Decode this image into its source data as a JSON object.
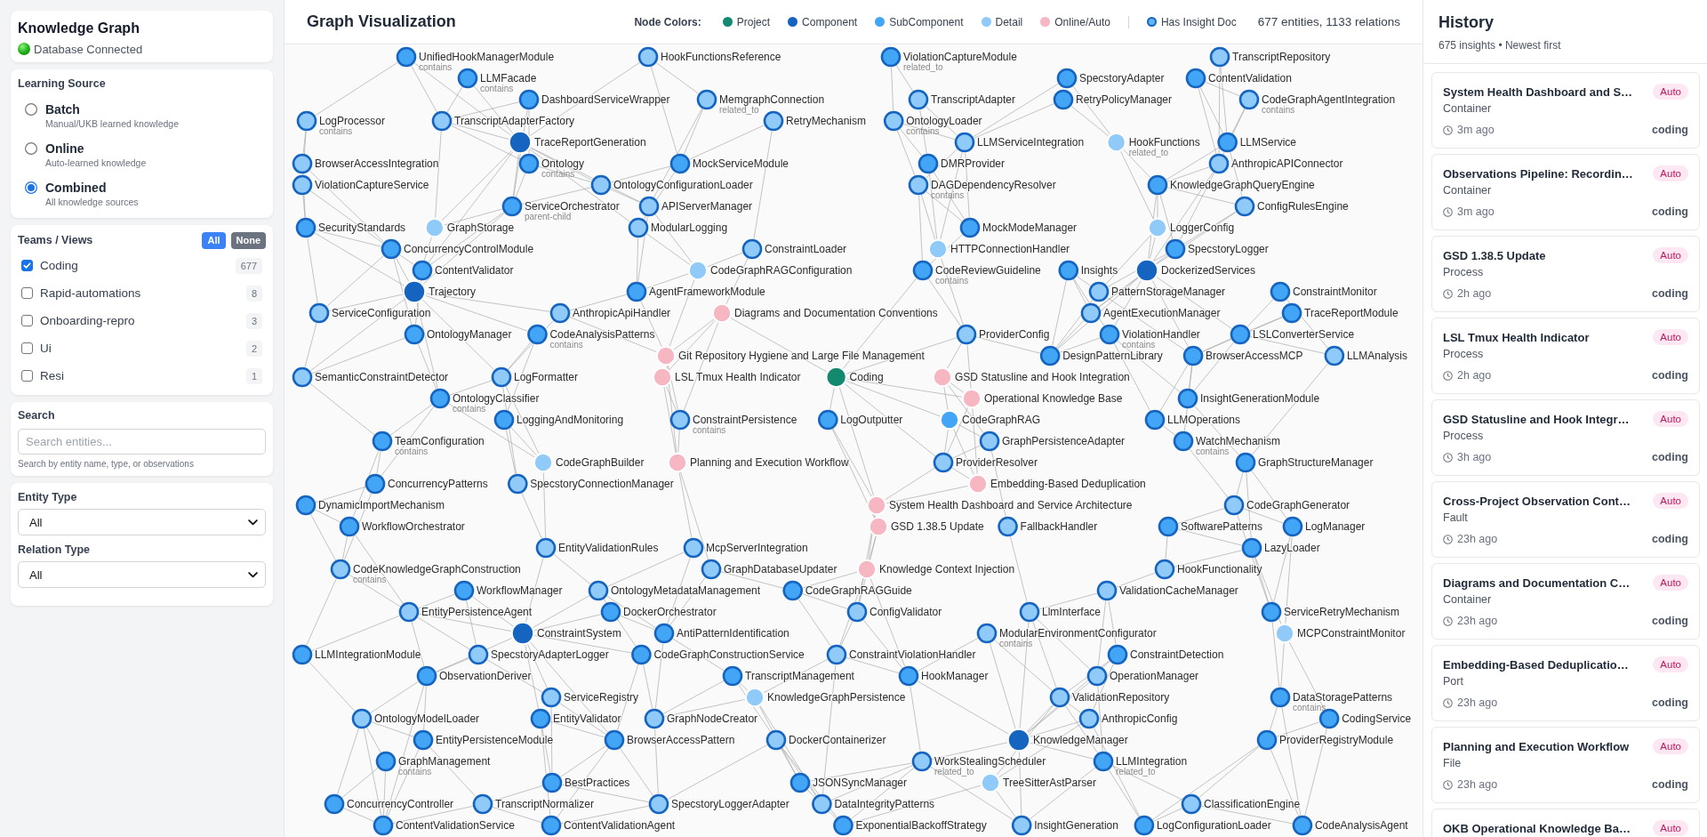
{
  "sidebar": {
    "title": "Knowledge Graph",
    "status": {
      "label": "Database Connected",
      "connected": true
    },
    "learning_source": {
      "label": "Learning Source",
      "options": [
        {
          "label": "Batch",
          "description": "Manual/UKB learned knowledge",
          "selected": false
        },
        {
          "label": "Online",
          "description": "Auto-learned knowledge",
          "selected": false
        },
        {
          "label": "Combined",
          "description": "All knowledge sources",
          "selected": true
        }
      ]
    },
    "teams": {
      "label": "Teams / Views",
      "buttons": [
        {
          "label": "All",
          "kind": "primary"
        },
        {
          "label": "None",
          "kind": "secondary"
        }
      ],
      "items": [
        {
          "name": "Coding",
          "checked": true,
          "count": "677"
        },
        {
          "name": "Rapid-automations",
          "checked": false,
          "count": "8"
        },
        {
          "name": "Onboarding-repro",
          "checked": false,
          "count": "3"
        },
        {
          "name": "Ui",
          "checked": false,
          "count": "2"
        },
        {
          "name": "Resi",
          "checked": false,
          "count": "1"
        }
      ]
    },
    "search": {
      "label": "Search",
      "placeholder": "Search entities...",
      "hint": "Search by entity name, type, or observations"
    },
    "filters": [
      {
        "label": "Entity Type",
        "value": "All"
      },
      {
        "label": "Relation Type",
        "value": "All"
      }
    ]
  },
  "graph": {
    "title": "Graph Visualization",
    "legend_title": "Node Colors:",
    "legend": [
      {
        "label": "Project",
        "kind": "project",
        "color": "#13896f"
      },
      {
        "label": "Component",
        "kind": "component",
        "color": "#1565c0"
      },
      {
        "label": "SubComponent",
        "kind": "subcomponent",
        "color": "#42a5f5"
      },
      {
        "label": "Detail",
        "kind": "detail",
        "color": "#90caf9"
      },
      {
        "label": "Online/Auto",
        "kind": "online",
        "color": "#f6b6c2"
      },
      {
        "label": "Has Insight Doc",
        "kind": "insight",
        "color": "#1565c0"
      }
    ],
    "stats": "677 entities, 1133 relations",
    "nodes": [
      {
        "name": "UnifiedHookManagerModule",
        "kind": "subcomponent",
        "insight_doc": true,
        "edge_label": "contains"
      },
      {
        "name": "HookFunctionsReference",
        "kind": "detail",
        "insight_doc": true
      },
      {
        "name": "ViolationCaptureModule",
        "kind": "subcomponent",
        "insight_doc": true,
        "edge_label": "related_to"
      },
      {
        "name": "TranscriptRepository",
        "kind": "detail",
        "insight_doc": true
      },
      {
        "name": "LLMFacade",
        "kind": "subcomponent",
        "insight_doc": true,
        "edge_label": "contains"
      },
      {
        "name": "SpecstoryAdapter",
        "kind": "subcomponent",
        "insight_doc": true
      },
      {
        "name": "ContentValidation",
        "kind": "subcomponent",
        "insight_doc": true
      },
      {
        "name": "DashboardServiceWrapper",
        "kind": "subcomponent",
        "insight_doc": true
      },
      {
        "name": "MemgraphConnection",
        "kind": "detail",
        "insight_doc": true,
        "edge_label": "related_to"
      },
      {
        "name": "TranscriptAdapter",
        "kind": "detail",
        "insight_doc": true
      },
      {
        "name": "RetryPolicyManager",
        "kind": "subcomponent",
        "insight_doc": true
      },
      {
        "name": "CodeGraphAgentIntegration",
        "kind": "detail",
        "insight_doc": true,
        "edge_label": "contains"
      },
      {
        "name": "LogProcessor",
        "kind": "detail",
        "insight_doc": true,
        "edge_label": "contains"
      },
      {
        "name": "TranscriptAdapterFactory",
        "kind": "detail",
        "insight_doc": true
      },
      {
        "name": "RetryMechanism",
        "kind": "detail",
        "insight_doc": true
      },
      {
        "name": "OntologyLoader",
        "kind": "detail",
        "insight_doc": true,
        "edge_label": "contains"
      },
      {
        "name": "TraceReportGeneration",
        "kind": "component",
        "insight_doc": false
      },
      {
        "name": "LLMServiceIntegration",
        "kind": "detail",
        "insight_doc": true
      },
      {
        "name": "HookFunctions",
        "kind": "detail",
        "insight_doc": false,
        "edge_label": "related_to"
      },
      {
        "name": "LLMService",
        "kind": "subcomponent",
        "insight_doc": true
      },
      {
        "name": "BrowserAccessIntegration",
        "kind": "detail",
        "insight_doc": true
      },
      {
        "name": "Ontology",
        "kind": "subcomponent",
        "insight_doc": true,
        "edge_label": "contains"
      },
      {
        "name": "MockServiceModule",
        "kind": "subcomponent",
        "insight_doc": true
      },
      {
        "name": "DMRProvider",
        "kind": "subcomponent",
        "insight_doc": true
      },
      {
        "name": "AnthropicAPIConnector",
        "kind": "detail",
        "insight_doc": true
      },
      {
        "name": "ViolationCaptureService",
        "kind": "detail",
        "insight_doc": true
      },
      {
        "name": "OntologyConfigurationLoader",
        "kind": "detail",
        "insight_doc": true
      },
      {
        "name": "DAGDependencyResolver",
        "kind": "detail",
        "insight_doc": true,
        "edge_label": "contains"
      },
      {
        "name": "KnowledgeGraphQueryEngine",
        "kind": "subcomponent",
        "insight_doc": true
      },
      {
        "name": "ServiceOrchestrator",
        "kind": "subcomponent",
        "insight_doc": true,
        "edge_label": "parent-child"
      },
      {
        "name": "APIServerManager",
        "kind": "detail",
        "insight_doc": true
      },
      {
        "name": "ConfigRulesEngine",
        "kind": "detail",
        "insight_doc": true
      },
      {
        "name": "SecurityStandards",
        "kind": "subcomponent",
        "insight_doc": true
      },
      {
        "name": "GraphStorage",
        "kind": "detail",
        "insight_doc": false
      },
      {
        "name": "ModularLogging",
        "kind": "detail",
        "insight_doc": true
      },
      {
        "name": "MockModeManager",
        "kind": "subcomponent",
        "insight_doc": true
      },
      {
        "name": "LoggerConfig",
        "kind": "detail",
        "insight_doc": false
      },
      {
        "name": "ConcurrencyControlModule",
        "kind": "subcomponent",
        "insight_doc": true
      },
      {
        "name": "ConstraintLoader",
        "kind": "detail",
        "insight_doc": true
      },
      {
        "name": "HTTPConnectionHandler",
        "kind": "detail",
        "insight_doc": false
      },
      {
        "name": "SpecstoryLogger",
        "kind": "subcomponent",
        "insight_doc": true
      },
      {
        "name": "ContentValidator",
        "kind": "subcomponent",
        "insight_doc": true
      },
      {
        "name": "CodeGraphRAGConfiguration",
        "kind": "detail",
        "insight_doc": false
      },
      {
        "name": "CodeReviewGuideline",
        "kind": "subcomponent",
        "insight_doc": true,
        "edge_label": "contains"
      },
      {
        "name": "Insights",
        "kind": "subcomponent",
        "insight_doc": true
      },
      {
        "name": "DockerizedServices",
        "kind": "component",
        "insight_doc": false
      },
      {
        "name": "Trajectory",
        "kind": "component",
        "insight_doc": false
      },
      {
        "name": "AgentFrameworkModule",
        "kind": "subcomponent",
        "insight_doc": true
      },
      {
        "name": "PatternStorageManager",
        "kind": "detail",
        "insight_doc": true
      },
      {
        "name": "ConstraintMonitor",
        "kind": "subcomponent",
        "insight_doc": true
      },
      {
        "name": "ServiceConfiguration",
        "kind": "detail",
        "insight_doc": true
      },
      {
        "name": "AnthropicApiHandler",
        "kind": "detail",
        "insight_doc": true
      },
      {
        "name": "Diagrams and Documentation Conventions",
        "kind": "online",
        "insight_doc": false
      },
      {
        "name": "AgentExecutionManager",
        "kind": "detail",
        "insight_doc": true
      },
      {
        "name": "TraceReportModule",
        "kind": "subcomponent",
        "insight_doc": true
      },
      {
        "name": "OntologyManager",
        "kind": "subcomponent",
        "insight_doc": true
      },
      {
        "name": "CodeAnalysisPatterns",
        "kind": "subcomponent",
        "insight_doc": true,
        "edge_label": "contains"
      },
      {
        "name": "ProviderConfig",
        "kind": "detail",
        "insight_doc": true
      },
      {
        "name": "ViolationHandler",
        "kind": "subcomponent",
        "insight_doc": true,
        "edge_label": "contains"
      },
      {
        "name": "LSLConverterService",
        "kind": "subcomponent",
        "insight_doc": true
      },
      {
        "name": "Git Repository Hygiene and Large File Management",
        "kind": "online",
        "insight_doc": false
      },
      {
        "name": "DesignPatternLibrary",
        "kind": "subcomponent",
        "insight_doc": true
      },
      {
        "name": "BrowserAccessMCP",
        "kind": "subcomponent",
        "insight_doc": true
      },
      {
        "name": "LLMAnalysis",
        "kind": "detail",
        "insight_doc": true
      },
      {
        "name": "SemanticConstraintDetector",
        "kind": "detail",
        "insight_doc": true
      },
      {
        "name": "LogFormatter",
        "kind": "detail",
        "insight_doc": true
      },
      {
        "name": "LSL Tmux Health Indicator",
        "kind": "online",
        "insight_doc": false
      },
      {
        "name": "Coding",
        "kind": "project",
        "insight_doc": false
      },
      {
        "name": "GSD Statusline and Hook Integration",
        "kind": "online",
        "insight_doc": false
      },
      {
        "name": "OntologyClassifier",
        "kind": "subcomponent",
        "insight_doc": true,
        "edge_label": "contains"
      },
      {
        "name": "Operational Knowledge Base",
        "kind": "online",
        "insight_doc": false
      },
      {
        "name": "InsightGenerationModule",
        "kind": "subcomponent",
        "insight_doc": true
      },
      {
        "name": "LoggingAndMonitoring",
        "kind": "subcomponent",
        "insight_doc": true
      },
      {
        "name": "ConstraintPersistence",
        "kind": "detail",
        "insight_doc": true,
        "edge_label": "contains"
      },
      {
        "name": "LogOutputter",
        "kind": "subcomponent",
        "insight_doc": true
      },
      {
        "name": "CodeGraphRAG",
        "kind": "subcomponent",
        "insight_doc": false
      },
      {
        "name": "LLMOperations",
        "kind": "subcomponent",
        "insight_doc": true
      },
      {
        "name": "TeamConfiguration",
        "kind": "subcomponent",
        "insight_doc": true,
        "edge_label": "contains"
      },
      {
        "name": "GraphPersistenceAdapter",
        "kind": "detail",
        "insight_doc": true
      },
      {
        "name": "WatchMechanism",
        "kind": "subcomponent",
        "insight_doc": true,
        "edge_label": "contains"
      },
      {
        "name": "CodeGraphBuilder",
        "kind": "detail",
        "insight_doc": false
      },
      {
        "name": "Planning and Execution Workflow",
        "kind": "online",
        "insight_doc": false
      },
      {
        "name": "ProviderResolver",
        "kind": "detail",
        "insight_doc": true
      },
      {
        "name": "GraphStructureManager",
        "kind": "subcomponent",
        "insight_doc": true
      },
      {
        "name": "ConcurrencyPatterns",
        "kind": "subcomponent",
        "insight_doc": true
      },
      {
        "name": "SpecstoryConnectionManager",
        "kind": "detail",
        "insight_doc": true
      },
      {
        "name": "Embedding-Based Deduplication",
        "kind": "online",
        "insight_doc": false
      },
      {
        "name": "DynamicImportMechanism",
        "kind": "subcomponent",
        "insight_doc": true
      },
      {
        "name": "System Health Dashboard and Service Architecture",
        "kind": "online",
        "insight_doc": false
      },
      {
        "name": "CodeGraphGenerator",
        "kind": "detail",
        "insight_doc": true
      },
      {
        "name": "WorkflowOrchestrator",
        "kind": "subcomponent",
        "insight_doc": true
      },
      {
        "name": "GSD 1.38.5 Update",
        "kind": "online",
        "insight_doc": false
      },
      {
        "name": "FallbackHandler",
        "kind": "detail",
        "insight_doc": true
      },
      {
        "name": "SoftwarePatterns",
        "kind": "subcomponent",
        "insight_doc": true
      },
      {
        "name": "LogManager",
        "kind": "subcomponent",
        "insight_doc": true
      },
      {
        "name": "EntityValidationRules",
        "kind": "detail",
        "insight_doc": true
      },
      {
        "name": "McpServerIntegration",
        "kind": "detail",
        "insight_doc": true
      },
      {
        "name": "LazyLoader",
        "kind": "subcomponent",
        "insight_doc": true
      },
      {
        "name": "CodeKnowledgeGraphConstruction",
        "kind": "detail",
        "insight_doc": true,
        "edge_label": "contains"
      },
      {
        "name": "GraphDatabaseUpdater",
        "kind": "detail",
        "insight_doc": true
      },
      {
        "name": "Knowledge Context Injection",
        "kind": "online",
        "insight_doc": false
      },
      {
        "name": "HookFunctionality",
        "kind": "detail",
        "insight_doc": true
      },
      {
        "name": "WorkflowManager",
        "kind": "subcomponent",
        "insight_doc": true
      },
      {
        "name": "OntologyMetadataManagement",
        "kind": "detail",
        "insight_doc": true
      },
      {
        "name": "CodeGraphRAGGuide",
        "kind": "subcomponent",
        "insight_doc": true
      },
      {
        "name": "ValidationCacheManager",
        "kind": "detail",
        "insight_doc": true
      },
      {
        "name": "EntityPersistenceAgent",
        "kind": "detail",
        "insight_doc": true
      },
      {
        "name": "DockerOrchestrator",
        "kind": "subcomponent",
        "insight_doc": true
      },
      {
        "name": "ConfigValidator",
        "kind": "detail",
        "insight_doc": true
      },
      {
        "name": "LlmInterface",
        "kind": "detail",
        "insight_doc": true
      },
      {
        "name": "ServiceRetryMechanism",
        "kind": "subcomponent",
        "insight_doc": true
      },
      {
        "name": "ConstraintSystem",
        "kind": "component",
        "insight_doc": false
      },
      {
        "name": "AntiPatternIdentification",
        "kind": "subcomponent",
        "insight_doc": true
      },
      {
        "name": "ModularEnvironmentConfigurator",
        "kind": "detail",
        "insight_doc": true,
        "edge_label": "contains"
      },
      {
        "name": "MCPConstraintMonitor",
        "kind": "detail",
        "insight_doc": false
      },
      {
        "name": "LLMIntegrationModule",
        "kind": "subcomponent",
        "insight_doc": true
      },
      {
        "name": "SpecstoryAdapterLogger",
        "kind": "detail",
        "insight_doc": true
      },
      {
        "name": "CodeGraphConstructionService",
        "kind": "subcomponent",
        "insight_doc": true
      },
      {
        "name": "ConstraintViolationHandler",
        "kind": "detail",
        "insight_doc": true
      },
      {
        "name": "ConstraintDetection",
        "kind": "subcomponent",
        "insight_doc": true
      },
      {
        "name": "ObservationDeriver",
        "kind": "subcomponent",
        "insight_doc": true
      },
      {
        "name": "TranscriptManagement",
        "kind": "subcomponent",
        "insight_doc": true
      },
      {
        "name": "HookManager",
        "kind": "subcomponent",
        "insight_doc": true
      },
      {
        "name": "OperationManager",
        "kind": "detail",
        "insight_doc": true
      },
      {
        "name": "ServiceRegistry",
        "kind": "detail",
        "insight_doc": true
      },
      {
        "name": "KnowledgeGraphPersistence",
        "kind": "detail",
        "insight_doc": false
      },
      {
        "name": "ValidationRepository",
        "kind": "detail",
        "insight_doc": true
      },
      {
        "name": "DataStoragePatterns",
        "kind": "subcomponent",
        "insight_doc": true,
        "edge_label": "contains"
      },
      {
        "name": "OntologyModelLoader",
        "kind": "detail",
        "insight_doc": true
      },
      {
        "name": "EntityValidator",
        "kind": "subcomponent",
        "insight_doc": true
      },
      {
        "name": "GraphNodeCreator",
        "kind": "detail",
        "insight_doc": true
      },
      {
        "name": "AnthropicConfig",
        "kind": "detail",
        "insight_doc": true
      },
      {
        "name": "CodingService",
        "kind": "subcomponent",
        "insight_doc": true
      },
      {
        "name": "EntityPersistenceModule",
        "kind": "subcomponent",
        "insight_doc": true
      },
      {
        "name": "BrowserAccessPattern",
        "kind": "subcomponent",
        "insight_doc": true
      },
      {
        "name": "DockerContainerizer",
        "kind": "detail",
        "insight_doc": true
      },
      {
        "name": "KnowledgeManager",
        "kind": "component",
        "insight_doc": false
      },
      {
        "name": "ProviderRegistryModule",
        "kind": "subcomponent",
        "insight_doc": true
      },
      {
        "name": "GraphManagement",
        "kind": "subcomponent",
        "insight_doc": true,
        "edge_label": "contains"
      },
      {
        "name": "WorkStealingScheduler",
        "kind": "detail",
        "insight_doc": true,
        "edge_label": "related_to"
      },
      {
        "name": "LLMIntegration",
        "kind": "subcomponent",
        "insight_doc": true,
        "edge_label": "related_to"
      },
      {
        "name": "BestPractices",
        "kind": "subcomponent",
        "insight_doc": true
      },
      {
        "name": "JSONSyncManager",
        "kind": "subcomponent",
        "insight_doc": true
      },
      {
        "name": "TreeSitterAstParser",
        "kind": "detail",
        "insight_doc": false
      },
      {
        "name": "ConcurrencyController",
        "kind": "subcomponent",
        "insight_doc": true
      },
      {
        "name": "TranscriptNormalizer",
        "kind": "detail",
        "insight_doc": true
      },
      {
        "name": "SpecstoryLoggerAdapter",
        "kind": "detail",
        "insight_doc": true
      },
      {
        "name": "DataIntegrityPatterns",
        "kind": "detail",
        "insight_doc": true
      },
      {
        "name": "ClassificationEngine",
        "kind": "detail",
        "insight_doc": true
      },
      {
        "name": "ContentValidationService",
        "kind": "subcomponent",
        "insight_doc": true
      },
      {
        "name": "ContentValidationAgent",
        "kind": "subcomponent",
        "insight_doc": true
      },
      {
        "name": "ExponentialBackoffStrategy",
        "kind": "subcomponent",
        "insight_doc": true
      },
      {
        "name": "InsightGeneration",
        "kind": "detail",
        "insight_doc": true
      },
      {
        "name": "LogConfigurationLoader",
        "kind": "subcomponent",
        "insight_doc": true
      },
      {
        "name": "CodeAnalysisAgent",
        "kind": "subcomponent",
        "insight_doc": true
      }
    ]
  },
  "history": {
    "title": "History",
    "subtitle": "675 insights • Newest first",
    "items": [
      {
        "title": "System Health Dashboard and S…",
        "badge": "Auto",
        "category": "Container",
        "time": "3m ago",
        "team": "coding"
      },
      {
        "title": "Observations Pipeline: Recordin…",
        "badge": "Auto",
        "category": "Container",
        "time": "3m ago",
        "team": "coding"
      },
      {
        "title": "GSD 1.38.5 Update",
        "badge": "Auto",
        "category": "Process",
        "time": "2h ago",
        "team": "coding"
      },
      {
        "title": "LSL Tmux Health Indicator",
        "badge": "Auto",
        "category": "Process",
        "time": "2h ago",
        "team": "coding"
      },
      {
        "title": "GSD Statusline and Hook Integr…",
        "badge": "Auto",
        "category": "Process",
        "time": "3h ago",
        "team": "coding"
      },
      {
        "title": "Cross-Project Observation Cont…",
        "badge": "Auto",
        "category": "Fault",
        "time": "23h ago",
        "team": "coding"
      },
      {
        "title": "Diagrams and Documentation C…",
        "badge": "Auto",
        "category": "Container",
        "time": "23h ago",
        "team": "coding"
      },
      {
        "title": "Embedding-Based Deduplicatio…",
        "badge": "Auto",
        "category": "Port",
        "time": "23h ago",
        "team": "coding"
      },
      {
        "title": "Planning and Execution Workflow",
        "badge": "Auto",
        "category": "File",
        "time": "23h ago",
        "team": "coding"
      },
      {
        "title": "OKB Operational Knowledge Ba…",
        "badge": "Auto"
      }
    ]
  }
}
